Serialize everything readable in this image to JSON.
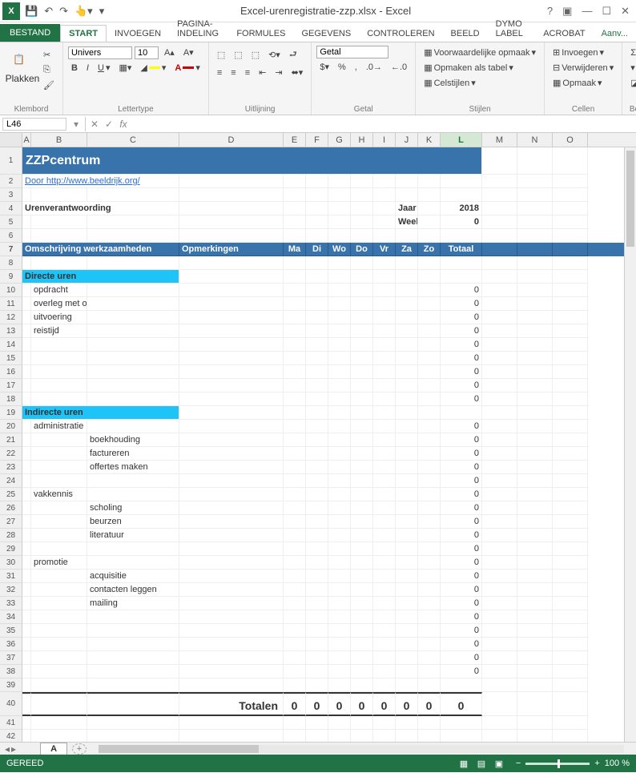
{
  "title": "Excel-urenregistratie-zzp.xlsx - Excel",
  "tabs": {
    "file": "BESTAND",
    "start": "START",
    "insert": "INVOEGEN",
    "layout": "PAGINA-INDELING",
    "formulas": "FORMULES",
    "data": "GEGEVENS",
    "review": "CONTROLEREN",
    "view": "BEELD",
    "dymo": "DYMO Label",
    "acrobat": "Acrobat",
    "addons": "Aanv..."
  },
  "ribbon": {
    "clipboard": {
      "paste": "Plakken",
      "group": "Klembord"
    },
    "font": {
      "name": "Univers",
      "size": "10",
      "group": "Lettertype"
    },
    "align": {
      "group": "Uitlijning"
    },
    "number": {
      "fmt": "Getal",
      "group": "Getal"
    },
    "styles": {
      "cond": "Voorwaardelijke opmaak",
      "table": "Opmaken als tabel",
      "cell": "Celstijlen",
      "group": "Stijlen"
    },
    "cells": {
      "insert": "Invoegen",
      "delete": "Verwijderen",
      "format": "Opmaak",
      "group": "Cellen"
    },
    "editing": {
      "group": "Bewerken"
    }
  },
  "namebox": "L46",
  "fx": "fx",
  "cols": [
    "A",
    "B",
    "C",
    "D",
    "E",
    "F",
    "G",
    "H",
    "I",
    "J",
    "K",
    "L",
    "M",
    "N",
    "O"
  ],
  "selectedCol": "L",
  "sheet": {
    "banner": "ZZPcentrum",
    "by": "Door http://www.beeldrijk.org/",
    "heading": "Urenverantwoording",
    "jaar_lbl": "Jaar",
    "jaar": "2018",
    "week_lbl": "Week",
    "week": "0",
    "th": {
      "desc": "Omschrijving werkzaamheden",
      "rem": "Opmerkingen",
      "ma": "Ma",
      "di": "Di",
      "wo": "Wo",
      "do": "Do",
      "vr": "Vr",
      "za": "Za",
      "zo": "Zo",
      "tot": "Totaal"
    },
    "sec1": "Directe uren",
    "r10": "opdracht",
    "r11": "overleg met opdrachtgever",
    "r12": "uitvoering",
    "r13": "reistijd",
    "sec2": "Indirecte uren",
    "r20": "administratie",
    "r21": "boekhouding",
    "r22": "factureren",
    "r23": "offertes maken",
    "r25": "vakkennis",
    "r26": "scholing",
    "r27": "beurzen",
    "r28": "literatuur",
    "r30": "promotie",
    "r31": "acquisitie",
    "r32": "contacten leggen",
    "r33": "mailing",
    "zero": "0",
    "totals": "Totalen",
    "t": "0"
  },
  "sheetTab": "A",
  "status": {
    "ready": "GEREED",
    "zoom": "100 %"
  }
}
